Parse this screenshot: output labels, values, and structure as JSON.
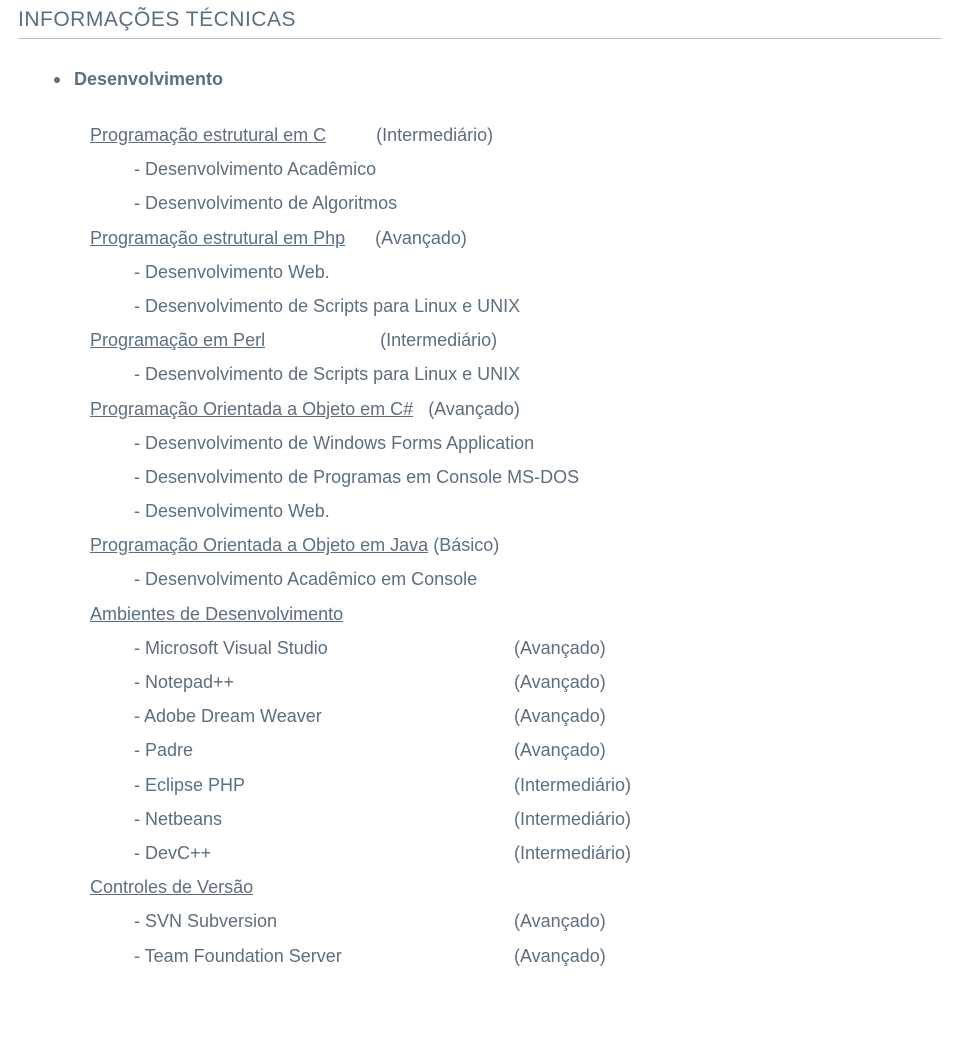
{
  "title": "INFORMAÇÕES TÉCNICAS",
  "sectionHeading": "Desenvolvimento",
  "skills": [
    {
      "name": "Programação estrutural em C",
      "spacer": "          ",
      "level": "(Intermediário)",
      "details": [
        "- Desenvolvimento Acadêmico",
        "- Desenvolvimento de Algoritmos"
      ]
    },
    {
      "name": "Programação estrutural em Php",
      "spacer": "      ",
      "level": "(Avançado)",
      "details": [
        "- Desenvolvimento Web.",
        "- Desenvolvimento de Scripts para Linux e UNIX"
      ]
    },
    {
      "name": "Programação em Perl",
      "spacer": "                       ",
      "level": "(Intermediário)",
      "details": [
        "- Desenvolvimento de Scripts para Linux e UNIX"
      ]
    },
    {
      "name": "Programação Orientada a Objeto em C#",
      "spacer": "   ",
      "level": "(Avançado)",
      "details": [
        "- Desenvolvimento de Windows Forms Application",
        "- Desenvolvimento de Programas em Console MS-DOS",
        "- Desenvolvimento Web."
      ]
    },
    {
      "name": "Programação Orientada a Objeto em Java",
      "spacer": " ",
      "level": "(Básico)",
      "details": [
        "- Desenvolvimento Acadêmico em Console"
      ]
    }
  ],
  "envHeading": "Ambientes de Desenvolvimento",
  "envs": [
    {
      "name": "- Microsoft Visual Studio",
      "level": "(Avançado)"
    },
    {
      "name": "- Notepad++",
      "level": "(Avançado)"
    },
    {
      "name": "- Adobe Dream Weaver",
      "level": "(Avançado)"
    },
    {
      "name": "- Padre",
      "level": "(Avançado)"
    },
    {
      "name": "- Eclipse PHP",
      "level": "(Intermediário)"
    },
    {
      "name": "- Netbeans",
      "level": "(Intermediário)"
    },
    {
      "name": "- DevC++",
      "level": "(Intermediário)"
    }
  ],
  "vcHeading": "Controles de Versão",
  "vcs": [
    {
      "name": "- SVN Subversion",
      "level": "(Avançado)"
    },
    {
      "name": "- Team Foundation Server",
      "level": "(Avançado)"
    }
  ]
}
